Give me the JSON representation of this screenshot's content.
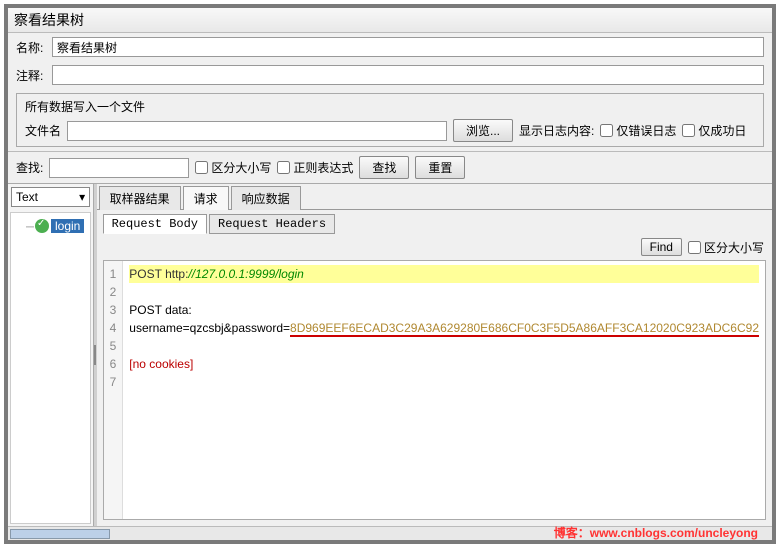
{
  "title": "察看结果树",
  "form": {
    "name_label": "名称:",
    "name_value": "察看结果树",
    "comment_label": "注释:",
    "comment_value": ""
  },
  "file_panel": {
    "header": "所有数据写入一个文件",
    "filename_label": "文件名",
    "filename_value": "",
    "browse_btn": "浏览...",
    "log_label": "显示日志内容:",
    "error_only": "仅错误日志",
    "success_only": "仅成功日"
  },
  "search": {
    "label": "查找:",
    "value": "",
    "case_sensitive": "区分大小写",
    "regex": "正则表达式",
    "search_btn": "查找",
    "reset_btn": "重置"
  },
  "tree": {
    "selector": "Text",
    "node": "login"
  },
  "tabs": {
    "sampler": "取样器结果",
    "request": "请求",
    "response": "响应数据"
  },
  "subtabs": {
    "body": "Request Body",
    "headers": "Request Headers"
  },
  "find": {
    "btn": "Find",
    "case": "区分大小写"
  },
  "code": {
    "l1a": "POST http:",
    "l1b": "//127.0.0.1:9999/login",
    "l3": "POST data:",
    "l4a": "username=qzcsbj&password=",
    "l4b": "8D969EEF6ECAD3C29A3A629280E686CF0C3F5D5A86AFF3CA12020C923ADC6C92",
    "l6": "[no cookies]"
  },
  "watermark": {
    "prefix": "博客：",
    "url": "www.cnblogs.com/uncleyong"
  }
}
